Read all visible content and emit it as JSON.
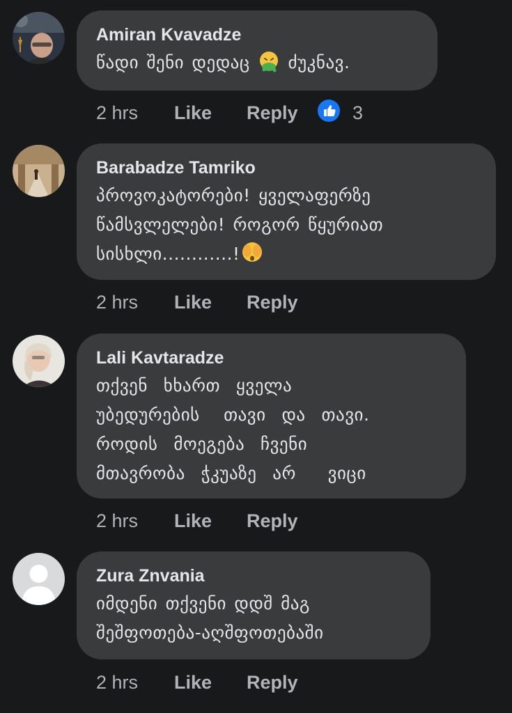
{
  "comments": [
    {
      "author": "Amiran Kvavadze",
      "text_before": "წადი შენი დედაც",
      "emoji": "vomiting-face",
      "text_after": " ძუკნავ.",
      "time": "2 hrs",
      "like": "Like",
      "reply": "Reply",
      "reaction_count": "3",
      "reaction_color": "#1877f2"
    },
    {
      "author": "Barabadze Tamriko",
      "text_lines": [
        "პროვოკატორები! ყველაფერზე",
        "წამსვლელები! როგორ წყურიათ",
        "სისხლი............!"
      ],
      "emoji": "face-with-hands-over-eyes",
      "time": "2 hrs",
      "like": "Like",
      "reply": "Reply"
    },
    {
      "author": "Lali Kavtaradze",
      "text_lines": [
        "თქვენ  ხხართ  ყველა",
        "უბედურების   თავი  და  თავი.",
        "როდის  მოეგება  ჩვენი",
        "მთავრობა  ჭკუაზე  არ    ვიცი"
      ],
      "time": "2 hrs",
      "like": "Like",
      "reply": "Reply"
    },
    {
      "author": "Zura Znvania",
      "text_lines": [
        "იმდენი თქვენი დდშ მაგ",
        "შეშფოთება-აღშფოთებაში"
      ],
      "time": "2 hrs",
      "like": "Like",
      "reply": "Reply"
    }
  ],
  "colors": {
    "background": "#18191a",
    "bubble": "#3a3b3c",
    "primary_text": "#e4e6eb",
    "secondary_text": "#b0b3b8",
    "like_blue": "#1877f2"
  }
}
